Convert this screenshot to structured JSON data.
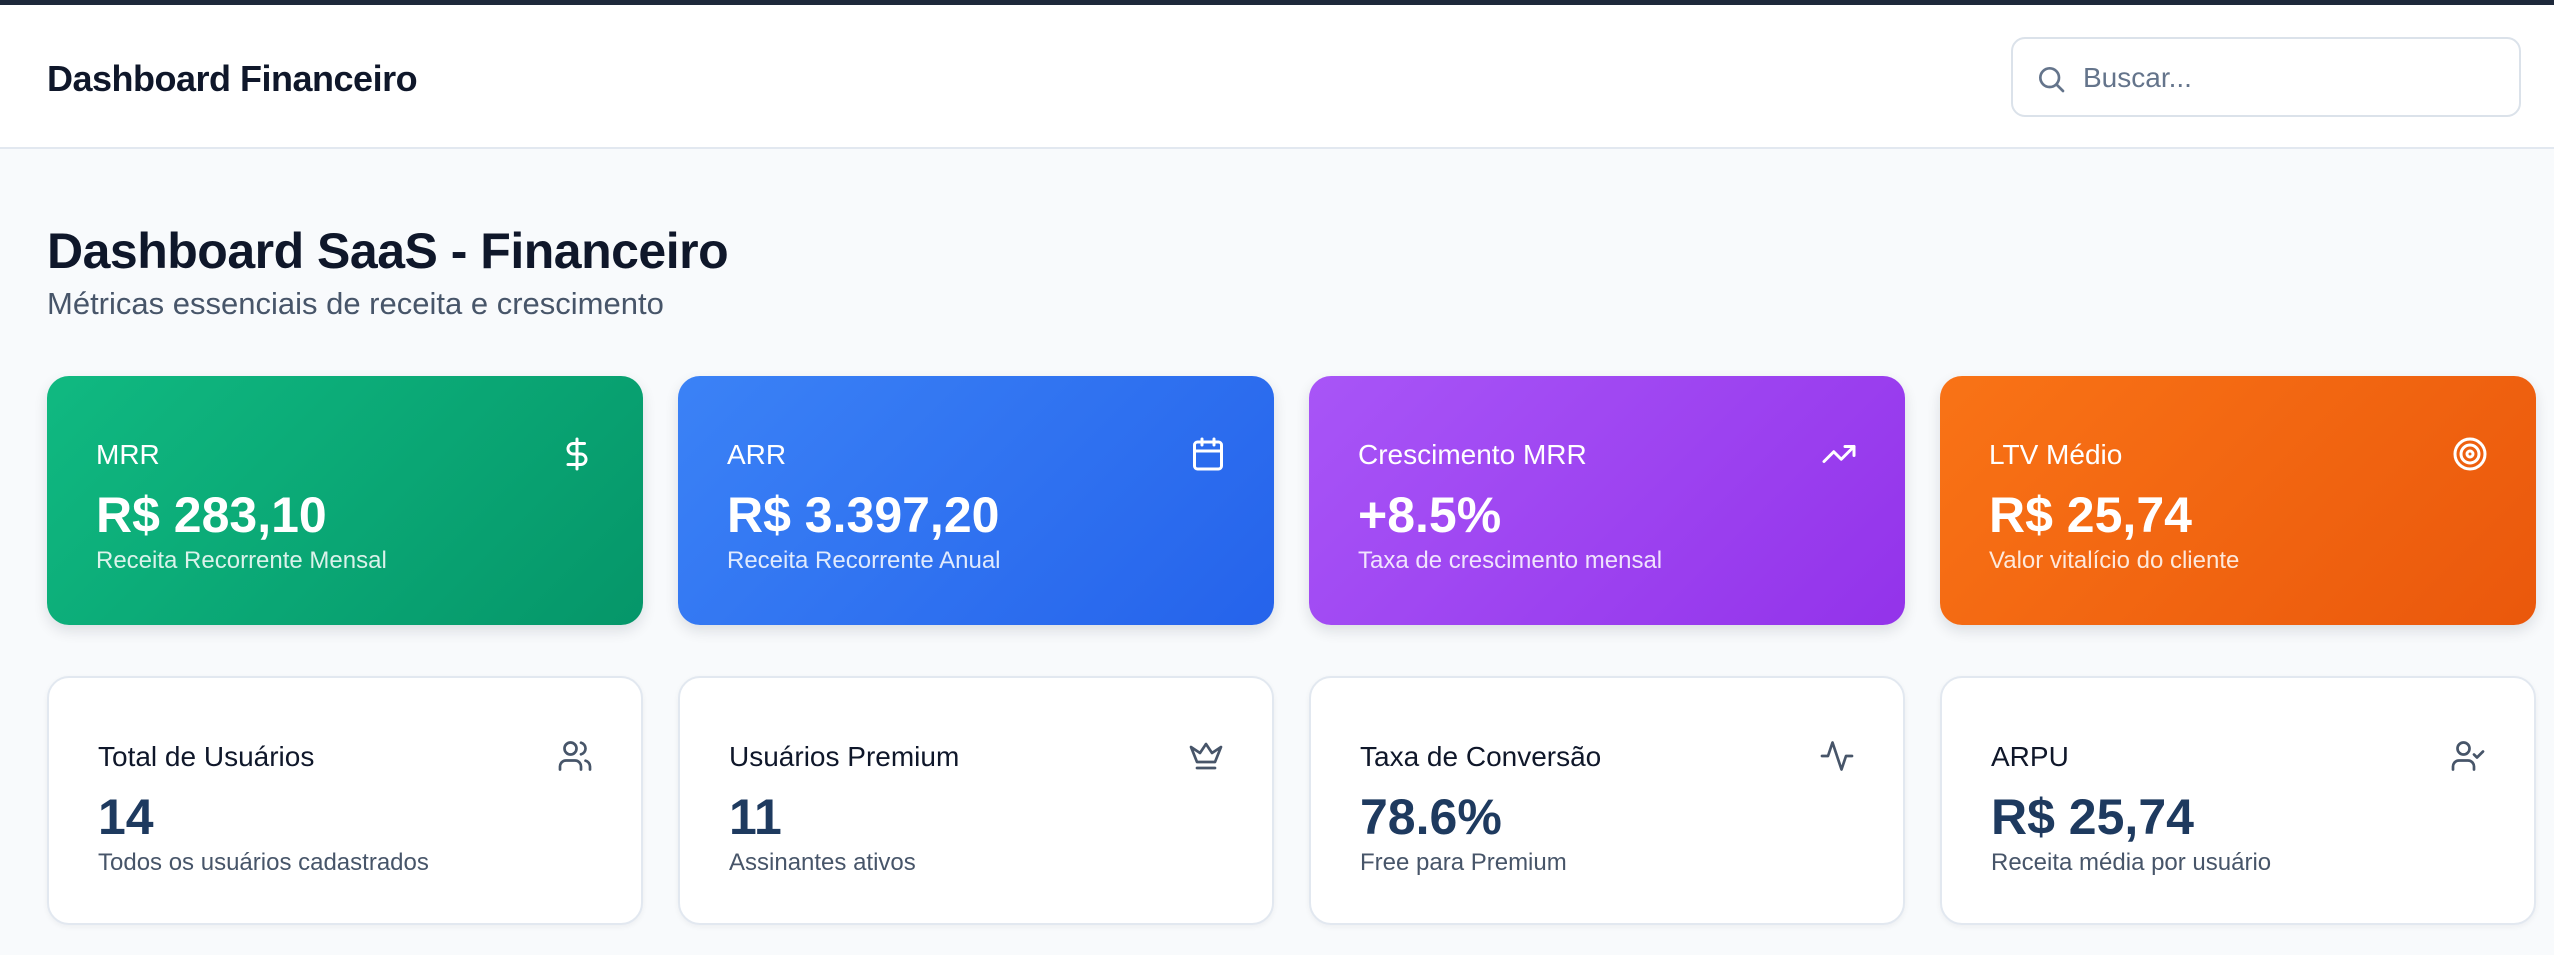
{
  "header": {
    "app_title": "Dashboard Financeiro",
    "search": {
      "placeholder": "Buscar...",
      "value": ""
    }
  },
  "page": {
    "title": "Dashboard SaaS - Financeiro",
    "subtitle": "Métricas essenciais de receita e crescimento"
  },
  "metric_cards": [
    {
      "label": "MRR",
      "value": "R$ 283,10",
      "description": "Receita Recorrente Mensal",
      "icon": "dollar-icon",
      "color": "#10b981"
    },
    {
      "label": "ARR",
      "value": "R$ 3.397,20",
      "description": "Receita Recorrente Anual",
      "icon": "calendar-icon",
      "color": "#3b82f6"
    },
    {
      "label": "Crescimento MRR",
      "value": "+8.5%",
      "description": "Taxa de crescimento mensal",
      "icon": "trending-up-icon",
      "color": "#a855f7"
    },
    {
      "label": "LTV Médio",
      "value": "R$ 25,74",
      "description": "Valor vitalício do cliente",
      "icon": "target-icon",
      "color": "#f97316"
    }
  ],
  "stat_cards": [
    {
      "label": "Total de Usuários",
      "value": "14",
      "description": "Todos os usuários cadastrados",
      "icon": "users-icon"
    },
    {
      "label": "Usuários Premium",
      "value": "11",
      "description": "Assinantes ativos",
      "icon": "crown-icon"
    },
    {
      "label": "Taxa de Conversão",
      "value": "78.6%",
      "description": "Free para Premium",
      "icon": "activity-icon"
    },
    {
      "label": "ARPU",
      "value": "R$ 25,74",
      "description": "Receita média por usuário",
      "icon": "user-check-icon"
    }
  ]
}
